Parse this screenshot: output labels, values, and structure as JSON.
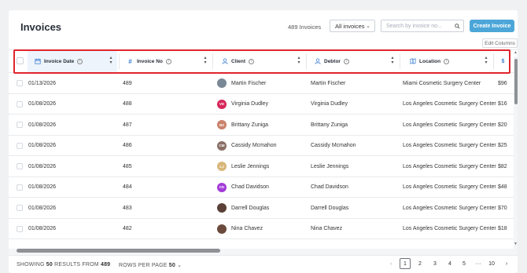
{
  "page": {
    "title": "Invoices",
    "count_label": "489 Invoices",
    "filter_value": "All invoices",
    "search_placeholder": "Search by invoice no...",
    "create_button": "Create Invoice",
    "edit_columns": "Edit Columns"
  },
  "columns": [
    {
      "label": "Invoice Date",
      "icon": "calendar-icon"
    },
    {
      "label": "Invoice No",
      "icon": "hash-icon"
    },
    {
      "label": "Client",
      "icon": "user-icon"
    },
    {
      "label": "Debtor",
      "icon": "user-icon"
    },
    {
      "label": "Location",
      "icon": "location-icon"
    }
  ],
  "rows": [
    {
      "date": "01/13/2026",
      "no": "489",
      "client": "Martin Fischer",
      "initials": "",
      "avatar_color": "#7a8896",
      "debtor": "Martin Fischer",
      "location": "Miami Cosmetic Surgery Center",
      "amount": "$96"
    },
    {
      "date": "01/08/2026",
      "no": "488",
      "client": "Virginia Dudley",
      "initials": "VD",
      "avatar_color": "#d6275a",
      "debtor": "Virginia Dudley",
      "location": "Los Angeles Cosmetic Surgery Center",
      "amount": "$16"
    },
    {
      "date": "01/08/2026",
      "no": "487",
      "client": "Brittany Zuniga",
      "initials": "BZ",
      "avatar_color": "#c9826b",
      "debtor": "Brittany Zuniga",
      "location": "Los Angeles Cosmetic Surgery Center",
      "amount": "$20"
    },
    {
      "date": "01/08/2026",
      "no": "486",
      "client": "Cassidy Mcmahon",
      "initials": "CM",
      "avatar_color": "#8a6f66",
      "debtor": "Cassidy Mcmahon",
      "location": "Los Angeles Cosmetic Surgery Center",
      "amount": "$25"
    },
    {
      "date": "01/08/2026",
      "no": "485",
      "client": "Leslie Jennings",
      "initials": "LJ",
      "avatar_color": "#d8b77a",
      "debtor": "Leslie Jennings",
      "location": "Los Angeles Cosmetic Surgery Center",
      "amount": "$82"
    },
    {
      "date": "01/08/2026",
      "no": "484",
      "client": "Chad Davidson",
      "initials": "CD",
      "avatar_color": "#a33bd9",
      "debtor": "Chad Davidson",
      "location": "Los Angeles Cosmetic Surgery Center",
      "amount": "$48"
    },
    {
      "date": "01/08/2026",
      "no": "483",
      "client": "Darrell Douglas",
      "initials": "",
      "avatar_color": "#5a4036",
      "debtor": "Darrell Douglas",
      "location": "Los Angeles Cosmetic Surgery Center",
      "amount": "$70"
    },
    {
      "date": "01/08/2026",
      "no": "482",
      "client": "Nina Chavez",
      "initials": "",
      "avatar_color": "#6b4a3c",
      "debtor": "Nina Chavez",
      "location": "Los Angeles Cosmetic Surgery Center",
      "amount": "$18"
    }
  ],
  "footer": {
    "showing_prefix": "SHOWING",
    "showing_count": "50",
    "results_from": "RESULTS FROM",
    "total": "489",
    "rows_per_page": "ROWS PER PAGE",
    "rows_per_page_value": "50",
    "pages": [
      "1",
      "2",
      "3",
      "4",
      "5",
      "···",
      "10"
    ],
    "active_page": "1"
  },
  "colors": {
    "accent": "#4ca6d8",
    "highlight": "#e0252b",
    "selected_header": "#eef4fc"
  }
}
